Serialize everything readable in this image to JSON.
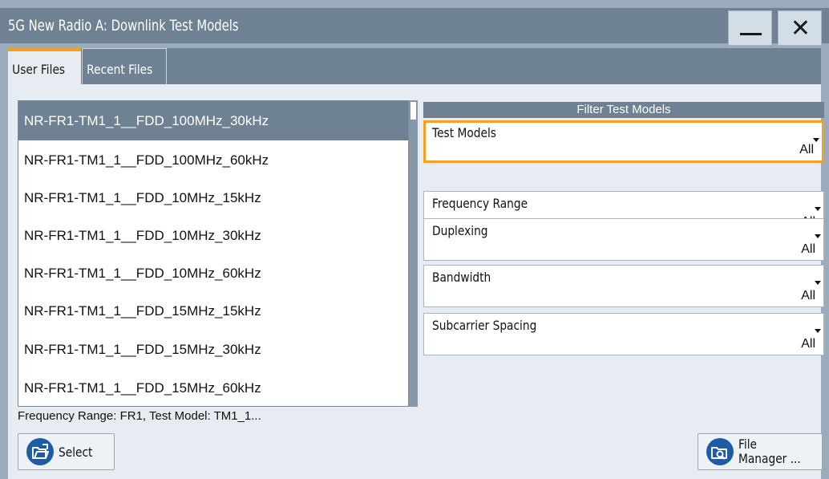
{
  "window": {
    "title": "5G New Radio A: Downlink Test Models",
    "minimize_icon": "minimize-icon",
    "close_glyph": "✕"
  },
  "tabs": [
    {
      "label": "User Files",
      "active": true
    },
    {
      "label": "Recent Files",
      "active": false
    }
  ],
  "files": {
    "items": [
      "NR-FR1-TM1_1__FDD_100MHz_30kHz",
      "NR-FR1-TM1_1__FDD_100MHz_60kHz",
      "NR-FR1-TM1_1__FDD_10MHz_15kHz",
      "NR-FR1-TM1_1__FDD_10MHz_30kHz",
      "NR-FR1-TM1_1__FDD_10MHz_60kHz",
      "NR-FR1-TM1_1__FDD_15MHz_15kHz",
      "NR-FR1-TM1_1__FDD_15MHz_30kHz",
      "NR-FR1-TM1_1__FDD_15MHz_60kHz"
    ],
    "selected_index": 0
  },
  "status_text": "Frequency Range: FR1, Test Model: TM1_1...",
  "filter": {
    "header": "Filter Test Models",
    "fields": [
      {
        "label": "Test Models",
        "value": "All",
        "focused": true
      },
      {
        "label": "Frequency Range",
        "value": "All",
        "focused": false
      },
      {
        "label": "Duplexing",
        "value": "All",
        "focused": false
      },
      {
        "label": "Bandwidth",
        "value": "All",
        "focused": false
      },
      {
        "label": "Subcarrier Spacing",
        "value": "All",
        "focused": false
      }
    ]
  },
  "buttons": {
    "select_label": "Select",
    "select_icon": "folder-open-icon",
    "file_manager_label_line1": "File",
    "file_manager_label_line2": "Manager ...",
    "file_manager_icon": "folder-search-icon"
  },
  "colors": {
    "accent": "#f5a01e",
    "titlebar": "#6e8293",
    "panel": "#e6ecf1",
    "icon_blue": "#1e5ca6"
  }
}
